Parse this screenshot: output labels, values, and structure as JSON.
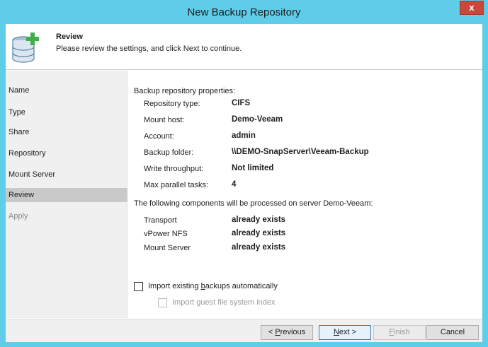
{
  "window": {
    "title": "New Backup Repository",
    "close_label": "x"
  },
  "header": {
    "title": "Review",
    "subtitle": "Please review the settings, and click Next to continue."
  },
  "steps": [
    {
      "label": "Name",
      "state": "normal"
    },
    {
      "label": "Type",
      "state": "normal"
    },
    {
      "label": "Share",
      "state": "normal"
    },
    {
      "label": "Repository",
      "state": "normal"
    },
    {
      "label": "Mount Server",
      "state": "normal"
    },
    {
      "label": "Review",
      "state": "active"
    },
    {
      "label": "Apply",
      "state": "disabled"
    }
  ],
  "properties": {
    "heading": "Backup repository properties:",
    "rows": [
      {
        "label": "Repository type:",
        "value": "CIFS"
      },
      {
        "label": "Mount host:",
        "value": "Demo-Veeam"
      },
      {
        "label": "Account:",
        "value": "admin"
      },
      {
        "label": "Backup folder:",
        "value": "\\\\DEMO-SnapServer\\Veeam-Backup"
      },
      {
        "label": "Write throughput:",
        "value": "Not limited"
      },
      {
        "label": "Max parallel tasks:",
        "value": "4"
      }
    ]
  },
  "components": {
    "heading": "The following components will be processed on server Demo-Veeam:",
    "rows": [
      {
        "name": "Transport",
        "status": "already exists"
      },
      {
        "name": "vPower NFS",
        "status": "already exists"
      },
      {
        "name": "Mount Server",
        "status": "already exists"
      }
    ]
  },
  "options": {
    "import_backups": {
      "pre": "Import existing ",
      "accel": "b",
      "post": "ackups automatically",
      "checked": false
    },
    "import_index": {
      "pre": "Import ",
      "accel": "g",
      "post": "uest file system index",
      "checked": false,
      "enabled": false
    }
  },
  "buttons": {
    "previous": {
      "pre": "< ",
      "accel": "P",
      "post": "revious"
    },
    "next": {
      "pre": "",
      "accel": "N",
      "post": "ext >"
    },
    "finish": {
      "pre": "",
      "accel": "F",
      "post": "inish"
    },
    "cancel": "Cancel"
  },
  "colors": {
    "title_bar": "#5fcdea",
    "close_button": "#c9483b",
    "active_step": "#c9c9c9",
    "sidebar": "#f0f0f0",
    "icon_green": "#3fae49",
    "icon_db": "#7f9fbf"
  },
  "icons": {
    "header": "database-add-icon",
    "close": "close-icon"
  }
}
